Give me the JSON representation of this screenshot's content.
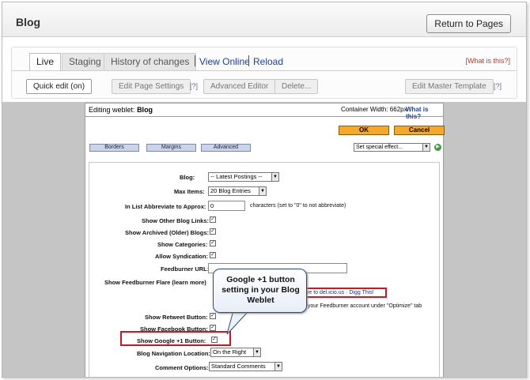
{
  "header": {
    "title": "Blog",
    "return_button": "Return to Pages"
  },
  "tabs": [
    {
      "label": "Live"
    },
    {
      "label": "Staging"
    },
    {
      "label": "History of changes"
    }
  ],
  "links": {
    "view_online": "View Online",
    "reload": "Reload",
    "what_is_this": "[What is this?]"
  },
  "toolbar": {
    "quick_edit": "Quick edit (on)",
    "edit_page_settings": "Edit Page Settings",
    "advanced_editor": "Advanced Editor",
    "delete": "Delete...",
    "edit_master_template": "Edit Master Template",
    "help": "[?]"
  },
  "weblet": {
    "editing_label": "Editing weblet:",
    "name": "Blog",
    "container_width": "Container Width: 662px",
    "what_is_this": "What is this?",
    "ok": "OK",
    "cancel": "Cancel",
    "tabs": [
      "Borders",
      "Margins",
      "Advanced"
    ],
    "special_effect": "Set special effect..."
  },
  "form": {
    "blog_label": "Blog:",
    "blog_value": "-- Latest Postings --",
    "max_items_label": "Max Items:",
    "max_items_value": "20 Blog Entries",
    "abbrev_label": "In List Abbreviate to Approx:",
    "abbrev_value": "0",
    "abbrev_note": "characters (set to \"0\" to not abbreviate)",
    "other_blog_links": "Show Other Blog Links:",
    "archived_blogs": "Show Archived (Older) Blogs:",
    "categories": "Show Categories:",
    "syndication": "Allow Syndication:",
    "feedburner_url": "Feedburner URL:",
    "feedburner_flare": "Show Feedburner Flare (learn more)",
    "flare_links": "ave to del.icio.us  · Digg This!",
    "flare_note": "n your Feedburner account under \"Optimize\" tab",
    "retweet": "Show Retweet Button:",
    "facebook": "Show Facebook Button:",
    "google_plus": "Show Google +1 Button:",
    "nav_location_label": "Blog Navigation Location:",
    "nav_location_value": "On the Right",
    "comment_label": "Comment Options:",
    "comment_value": "Standard Comments"
  },
  "callout": {
    "text": "Google +1 button setting in your Blog Weblet"
  },
  "icons": {
    "checkbox": "check-mark",
    "dropdown": "down-arrow",
    "go": "go-arrow-icon"
  }
}
